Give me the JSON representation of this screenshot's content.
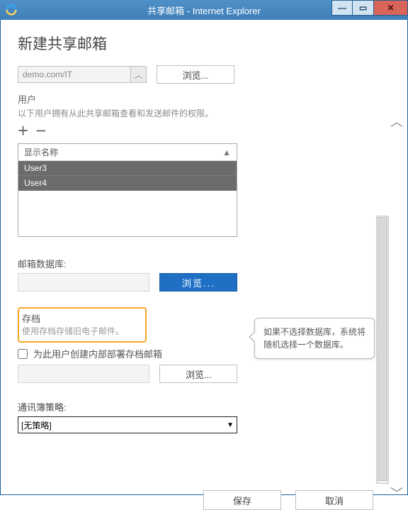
{
  "window": {
    "title": "共享邮箱 - Internet Explorer"
  },
  "page": {
    "heading": "新建共享邮箱"
  },
  "top_combo": {
    "value": "demo.com/IT",
    "browse_label": "浏览..."
  },
  "users": {
    "label": "用户",
    "sub": "以下用户拥有从此共享邮箱查看和发送邮件的权限。",
    "add_icon": "+",
    "remove_icon": "−",
    "column_header": "显示名称",
    "sort_glyph": "▲",
    "rows": [
      "User3",
      "User4"
    ]
  },
  "database": {
    "label": "邮箱数据库:",
    "value": "",
    "browse_label": "浏览...",
    "callout": "如果不选择数据库，系统将随机选择一个数据库。"
  },
  "archive": {
    "title": "存档",
    "sub": "使用存档存储旧电子邮件。",
    "checkbox_label": "为此用户创建内部部署存档邮箱",
    "browse_label": "浏览..."
  },
  "abp": {
    "label": "通讯簿策略:",
    "selected": "[无策略]"
  },
  "footer": {
    "save": "保存",
    "cancel": "取消"
  }
}
